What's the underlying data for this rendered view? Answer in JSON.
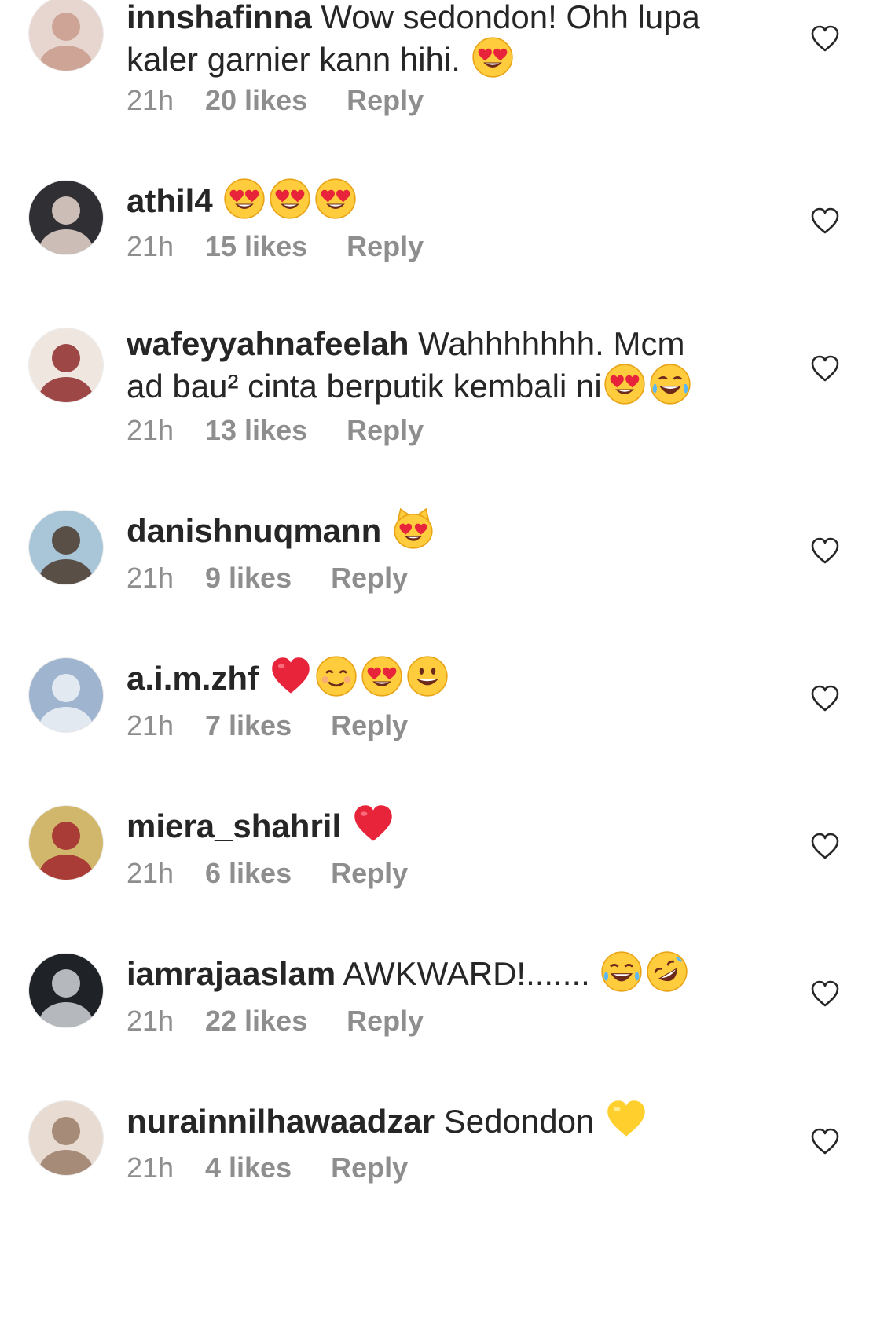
{
  "comments": [
    {
      "username": "innshafinna",
      "text": " Wow sedondon! Ohh lupa kaler garnier kann hihi. ",
      "emojis": [
        "heart-eyes"
      ],
      "time": "21h",
      "likes": "20 likes",
      "reply": "Reply",
      "avatar_colors": [
        "#e7d6cf",
        "#c89b8b"
      ]
    },
    {
      "username": "athil4",
      "text": " ",
      "emojis": [
        "heart-eyes",
        "heart-eyes",
        "heart-eyes"
      ],
      "time": "21h",
      "likes": "15 likes",
      "reply": "Reply",
      "avatar_colors": [
        "#2f2f34",
        "#e8d7cf"
      ]
    },
    {
      "username": "wafeyyahnafeelah",
      "text": " Wahhhhhhh. Mcm ad bau² cinta berputik kembali ni",
      "emojis": [
        "heart-eyes",
        "laughing"
      ],
      "time": "21h",
      "likes": "13 likes",
      "reply": "Reply",
      "avatar_colors": [
        "#efe6df",
        "#8e2c2b"
      ]
    },
    {
      "username": "danishnuqmann",
      "text": " ",
      "emojis": [
        "cat-heart-eyes"
      ],
      "time": "21h",
      "likes": "9 likes",
      "reply": "Reply",
      "avatar_colors": [
        "#a8c6d8",
        "#4b3a2d"
      ]
    },
    {
      "username": "a.i.m.zhf",
      "text": " ",
      "emojis": [
        "red-heart",
        "smiling",
        "heart-eyes",
        "grinning"
      ],
      "time": "21h",
      "likes": "7 likes",
      "reply": "Reply",
      "avatar_colors": [
        "#9fb4cf",
        "#eef2f7"
      ]
    },
    {
      "username": "miera_shahril",
      "text": " ",
      "emojis": [
        "red-heart"
      ],
      "time": "21h",
      "likes": "6 likes",
      "reply": "Reply",
      "avatar_colors": [
        "#d1b76c",
        "#a3272e"
      ]
    },
    {
      "username": "iamrajaaslam",
      "text": " AWKWARD!....... ",
      "emojis": [
        "laughing",
        "rofl"
      ],
      "time": "21h",
      "likes": "22 likes",
      "reply": "Reply",
      "avatar_colors": [
        "#1f2227",
        "#d0d3d8"
      ]
    },
    {
      "username": "nurainnilhawaadzar",
      "text": " Sedondon ",
      "emojis": [
        "yellow-heart"
      ],
      "time": "21h",
      "likes": "4 likes",
      "reply": "Reply",
      "avatar_colors": [
        "#e8dbd2",
        "#9a7d68"
      ]
    }
  ],
  "like_icon": "heart-outline-icon",
  "colors": {
    "text": "#262626",
    "secondary": "#8e8e8e",
    "background": "#ffffff"
  }
}
